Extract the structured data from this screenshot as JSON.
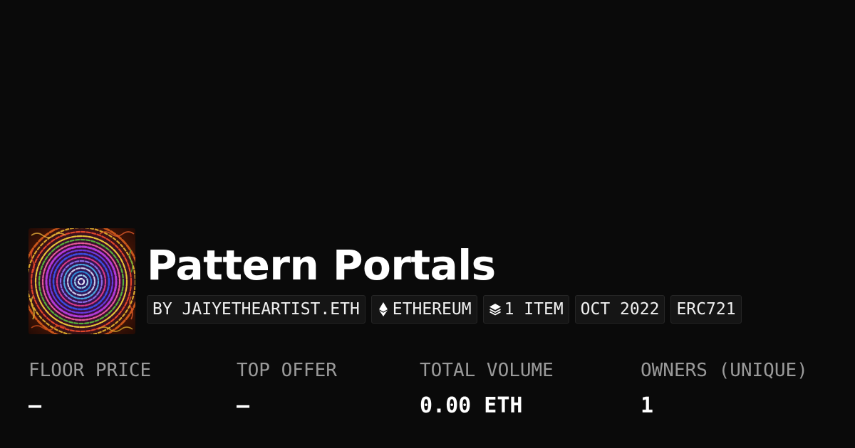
{
  "collection": {
    "title": "Pattern Portals",
    "thumbnail_icon": "pattern-portals-artwork",
    "chips": [
      {
        "label": "BY JAIYETHEARTIST.ETH",
        "icon": ""
      },
      {
        "label": "ETHEREUM",
        "icon": "ethereum-icon"
      },
      {
        "label": "1 ITEM",
        "icon": "layers-icon"
      },
      {
        "label": "OCT 2022",
        "icon": ""
      },
      {
        "label": "ERC721",
        "icon": ""
      }
    ]
  },
  "stats": [
    {
      "label": "FLOOR PRICE",
      "value": "—"
    },
    {
      "label": "TOP OFFER",
      "value": "—"
    },
    {
      "label": "TOTAL VOLUME",
      "value": "0.00 ETH"
    },
    {
      "label": "OWNERS (UNIQUE)",
      "value": "1"
    }
  ],
  "colors": {
    "background": "#0a0a0a",
    "chip_background": "#151515",
    "chip_border": "#262626",
    "label": "#9a9a9a",
    "text": "#ffffff"
  }
}
